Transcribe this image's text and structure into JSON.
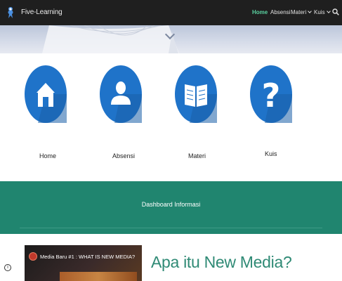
{
  "header": {
    "site_title": "Five-Learning",
    "nav": [
      {
        "label": "Home",
        "active": true
      },
      {
        "label": "Absensi",
        "active": false
      },
      {
        "label": "Materi",
        "active": false,
        "dropdown": true
      },
      {
        "label": "Kuis",
        "active": false,
        "dropdown": true
      }
    ]
  },
  "icons": [
    {
      "label": "Home",
      "icon": "house-icon"
    },
    {
      "label": "Absensi",
      "icon": "person-icon"
    },
    {
      "label": "Materi",
      "icon": "book-icon"
    },
    {
      "label": "Kuis",
      "icon": "question-mark-icon"
    }
  ],
  "dashboard": {
    "title": "Dashboard Informasi"
  },
  "video": {
    "title": "Media Baru #1 : WHAT IS NEW MEDIA?"
  },
  "article": {
    "title": "Apa itu New Media?"
  },
  "colors": {
    "topbar": "#1f1f1f",
    "nav_active": "#5ad1a0",
    "icon_circle": "#1f73c9",
    "band": "#20856f",
    "article_title": "#2f8a75"
  }
}
